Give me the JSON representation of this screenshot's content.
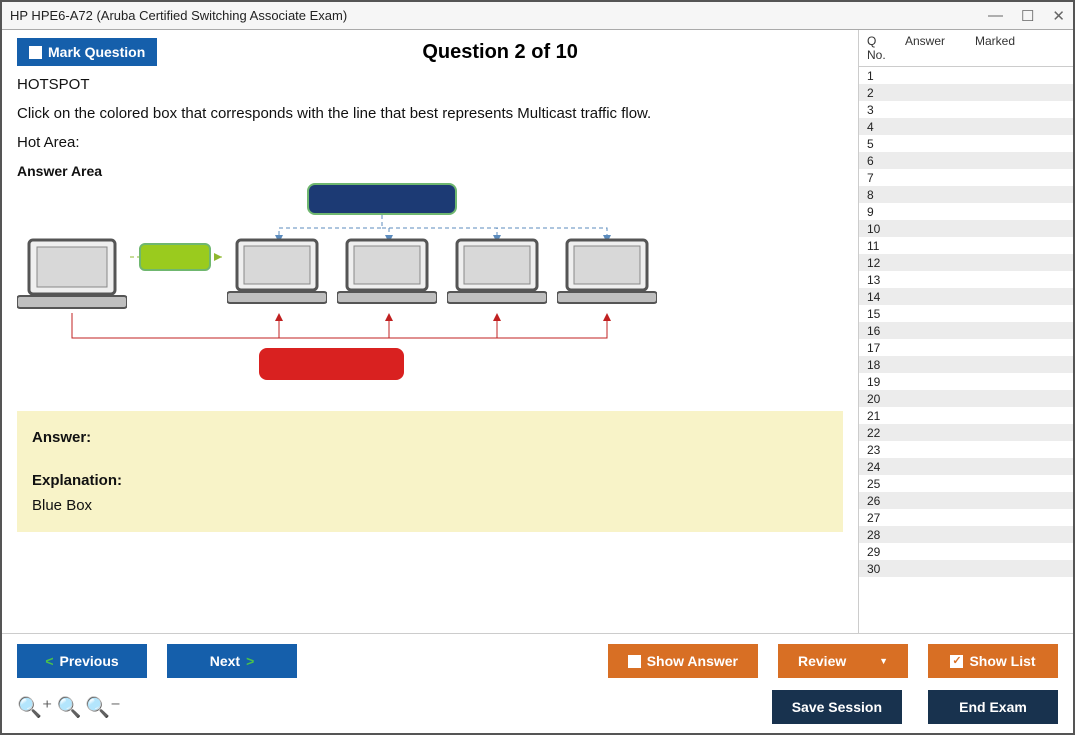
{
  "window": {
    "title": "HP HPE6-A72 (Aruba Certified Switching Associate Exam)"
  },
  "header": {
    "mark_label": "Mark Question",
    "question_title": "Question 2 of 10"
  },
  "question": {
    "type_label": "HOTSPOT",
    "prompt": "Click on the colored box that corresponds with the line that best represents Multicast traffic flow.",
    "hot_area_label": "Hot Area:",
    "answer_area_label": "Answer Area"
  },
  "answer_panel": {
    "answer_label": "Answer:",
    "explanation_label": "Explanation:",
    "explanation_text": "Blue Box"
  },
  "sidebar": {
    "col_qno": "Q No.",
    "col_answer": "Answer",
    "col_marked": "Marked",
    "total_rows": 30
  },
  "footer": {
    "previous": "Previous",
    "next": "Next",
    "show_answer": "Show Answer",
    "review": "Review",
    "show_list": "Show List",
    "save_session": "Save Session",
    "end_exam": "End Exam"
  }
}
